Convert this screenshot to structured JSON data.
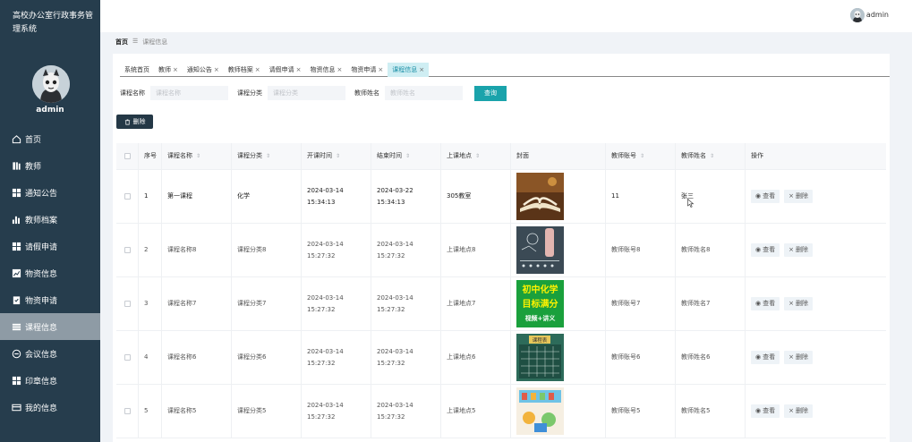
{
  "app": {
    "system_title": "高校办公室行政事务管理系统",
    "user_name": "admin"
  },
  "header": {
    "user_name": "admin"
  },
  "sidebar": {
    "items": [
      {
        "label": "首页",
        "icon": "home-icon"
      },
      {
        "label": "教师",
        "icon": "book-icon"
      },
      {
        "label": "通知公告",
        "icon": "grid-icon"
      },
      {
        "label": "教师档案",
        "icon": "bar-chart-icon"
      },
      {
        "label": "请假申请",
        "icon": "grid-icon"
      },
      {
        "label": "物资信息",
        "icon": "line-chart-icon"
      },
      {
        "label": "物资申请",
        "icon": "clipboard-icon"
      },
      {
        "label": "课程信息",
        "icon": "list-icon"
      },
      {
        "label": "会议信息",
        "icon": "minus-circle-icon"
      },
      {
        "label": "印章信息",
        "icon": "grid-icon"
      },
      {
        "label": "我的信息",
        "icon": "card-icon"
      }
    ],
    "active_index": 7
  },
  "breadcrumb": {
    "home": "首页",
    "separator": "☰",
    "current": "课程信息"
  },
  "tabs": [
    {
      "label": "系统首页",
      "closable": false
    },
    {
      "label": "教师",
      "closable": true
    },
    {
      "label": "通知公告",
      "closable": true
    },
    {
      "label": "教师档案",
      "closable": true
    },
    {
      "label": "请假申请",
      "closable": true
    },
    {
      "label": "物资信息",
      "closable": true
    },
    {
      "label": "物资申请",
      "closable": true
    },
    {
      "label": "课程信息",
      "closable": true,
      "active": true
    }
  ],
  "search": {
    "course_name_label": "课程名称",
    "course_name_placeholder": "课程名称",
    "category_label": "课程分类",
    "category_placeholder": "课程分类",
    "teacher_label": "教师姓名",
    "teacher_placeholder": "教师姓名",
    "query_button": "查询"
  },
  "toolbar": {
    "delete_label": "删除"
  },
  "table": {
    "headers": [
      "序号",
      "课程名称",
      "课程分类",
      "开课时间",
      "结束时间",
      "上课地点",
      "封面",
      "教师账号",
      "教师姓名",
      "操作"
    ],
    "rows": [
      {
        "seq": "1",
        "name": "第一课程",
        "category": "化学",
        "start": "2024-03-14 15:34:13",
        "end": "2024-03-22 15:34:13",
        "location": "305教室",
        "cover": "book",
        "account": "11",
        "teacher": "张三"
      },
      {
        "seq": "2",
        "name": "课程名称8",
        "category": "课程分类8",
        "start": "2024-03-14 15:27:32",
        "end": "2024-03-14 15:27:32",
        "location": "上课地点8",
        "cover": "chalk",
        "account": "教师账号8",
        "teacher": "教师姓名8"
      },
      {
        "seq": "3",
        "name": "课程名称7",
        "category": "课程分类7",
        "start": "2024-03-14 15:27:32",
        "end": "2024-03-14 15:27:32",
        "location": "上课地点7",
        "cover": "chem",
        "account": "教师账号7",
        "teacher": "教师姓名7"
      },
      {
        "seq": "4",
        "name": "课程名称6",
        "category": "课程分类6",
        "start": "2024-03-14 15:27:32",
        "end": "2024-03-14 15:27:32",
        "location": "上课地点6",
        "cover": "board",
        "account": "教师账号6",
        "teacher": "教师姓名6"
      },
      {
        "seq": "5",
        "name": "课程名称5",
        "category": "课程分类5",
        "start": "2024-03-14 15:27:32",
        "end": "2024-03-14 15:27:32",
        "location": "上课地点5",
        "cover": "kids",
        "account": "教师账号5",
        "teacher": "教师姓名5"
      }
    ],
    "view_label": "查看",
    "delete_label": "删除"
  },
  "covers": {
    "chem_line1": "初中化学",
    "chem_line2": "目标满分",
    "chem_line3": "视频+讲义",
    "board_title": "课程表"
  },
  "colors": {
    "sidebar_bg": "#263d4d",
    "accent": "#1aa3ab",
    "active_tab": "#cfeef3"
  }
}
